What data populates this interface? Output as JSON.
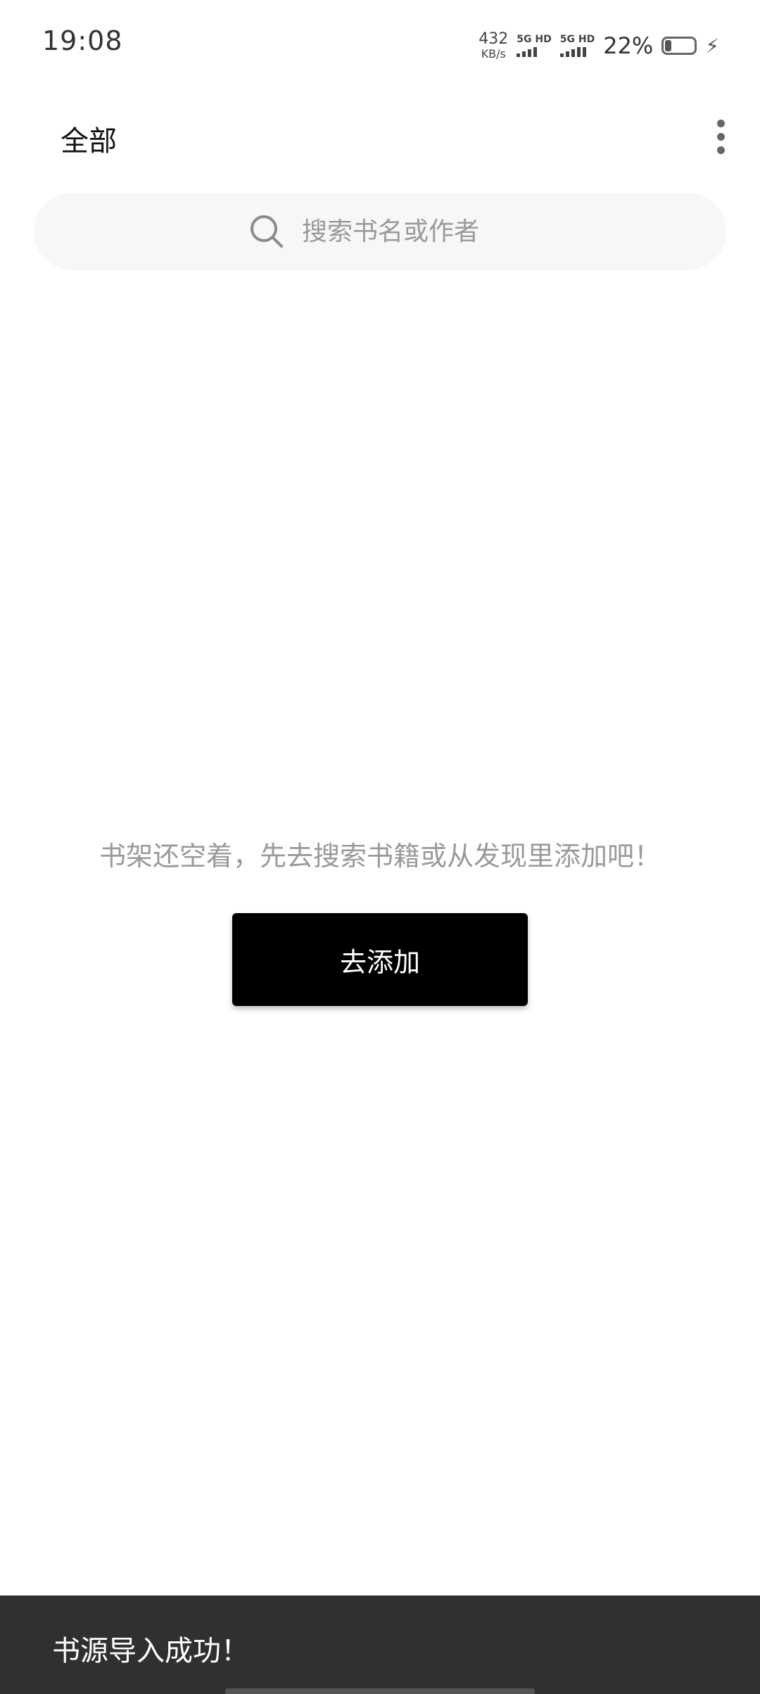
{
  "status_bar": {
    "time": "19:08",
    "net_speed_value": "432",
    "net_speed_unit": "KB/s",
    "sim1_label": "5G HD",
    "sim2_label": "5G HD",
    "battery_percent": "22%",
    "battery_level": 0.22,
    "charging_icon": "bolt-icon"
  },
  "top_bar": {
    "title": "全部",
    "more_icon": "more-vertical-icon"
  },
  "search": {
    "placeholder": "搜索书名或作者",
    "icon": "search-icon"
  },
  "empty_state": {
    "message": "书架还空着，先去搜索书籍或从发现里添加吧！",
    "button_label": "去添加"
  },
  "snackbar": {
    "message": "书源导入成功！"
  },
  "colors": {
    "background": "#ffffff",
    "search_bg": "#f7f7f7",
    "button_bg": "#000000",
    "snackbar_bg": "#303030",
    "muted_text": "#9a9a9a"
  }
}
